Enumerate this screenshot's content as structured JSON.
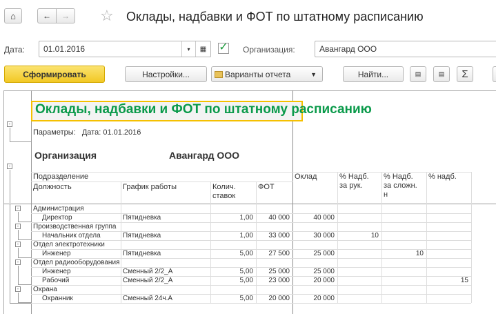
{
  "window": {
    "title": "Оклады, надбавки и ФОТ по штатному расписанию"
  },
  "filters": {
    "date_label": "Дата:",
    "date_value": "01.01.2016",
    "org_checked": true,
    "org_label": "Организация:",
    "org_value": "Авангард ООО"
  },
  "toolbar": {
    "generate": "Сформировать",
    "settings": "Настройки...",
    "variants": "Варианты отчета",
    "find": "Найти...",
    "sum": "Σ"
  },
  "report": {
    "title": "Оклады, надбавки и ФОТ по штатному расписанию",
    "params": "Параметры:   Дата: 01.01.2016",
    "org_label": "Организация",
    "org_value": "Авангард ООО",
    "headers": {
      "division": "Подразделение",
      "position": "Должность",
      "schedule": "График работы",
      "rates": "Колич. ставок",
      "fot": "ФОТ",
      "salary": "Оклад",
      "pct_head": "% Надб. за рук.",
      "pct_complex": "% Надб. за сложн. н",
      "pct_other": "% надб."
    },
    "groups": [
      {
        "name": "Администрация",
        "rows": [
          {
            "position": "Директор",
            "schedule": "Пятидневка",
            "rates": "1,00",
            "fot": "40 000",
            "salary": "40 000",
            "pct_head": "",
            "pct_complex": "",
            "pct_other": ""
          }
        ]
      },
      {
        "name": "Производственная группа",
        "rows": [
          {
            "position": "Начальник отдела",
            "schedule": "Пятидневка",
            "rates": "1,00",
            "fot": "33 000",
            "salary": "30 000",
            "pct_head": "10",
            "pct_complex": "",
            "pct_other": ""
          }
        ]
      },
      {
        "name": "Отдел электротехники",
        "rows": [
          {
            "position": "Инженер",
            "schedule": "Пятидневка",
            "rates": "5,00",
            "fot": "27 500",
            "salary": "25 000",
            "pct_head": "",
            "pct_complex": "10",
            "pct_other": ""
          }
        ]
      },
      {
        "name": "Отдел радиооборудования",
        "rows": [
          {
            "position": "Инженер",
            "schedule": "Сменный 2/2_А",
            "rates": "5,00",
            "fot": "25 000",
            "salary": "25 000",
            "pct_head": "",
            "pct_complex": "",
            "pct_other": ""
          },
          {
            "position": "Рабочий",
            "schedule": "Сменный 2/2_А",
            "rates": "5,00",
            "fot": "23 000",
            "salary": "20 000",
            "pct_head": "",
            "pct_complex": "",
            "pct_other": "15"
          }
        ]
      },
      {
        "name": "Охрана",
        "rows": [
          {
            "position": "Охранник",
            "schedule": "Сменный 24ч.А",
            "rates": "5,00",
            "fot": "20 000",
            "salary": "20 000",
            "pct_head": "",
            "pct_complex": "",
            "pct_other": ""
          }
        ]
      }
    ]
  },
  "colors": {
    "accent_yellow": "#f5d33a",
    "title_green": "#0a9a4a",
    "check_green": "#1a9a3a"
  }
}
